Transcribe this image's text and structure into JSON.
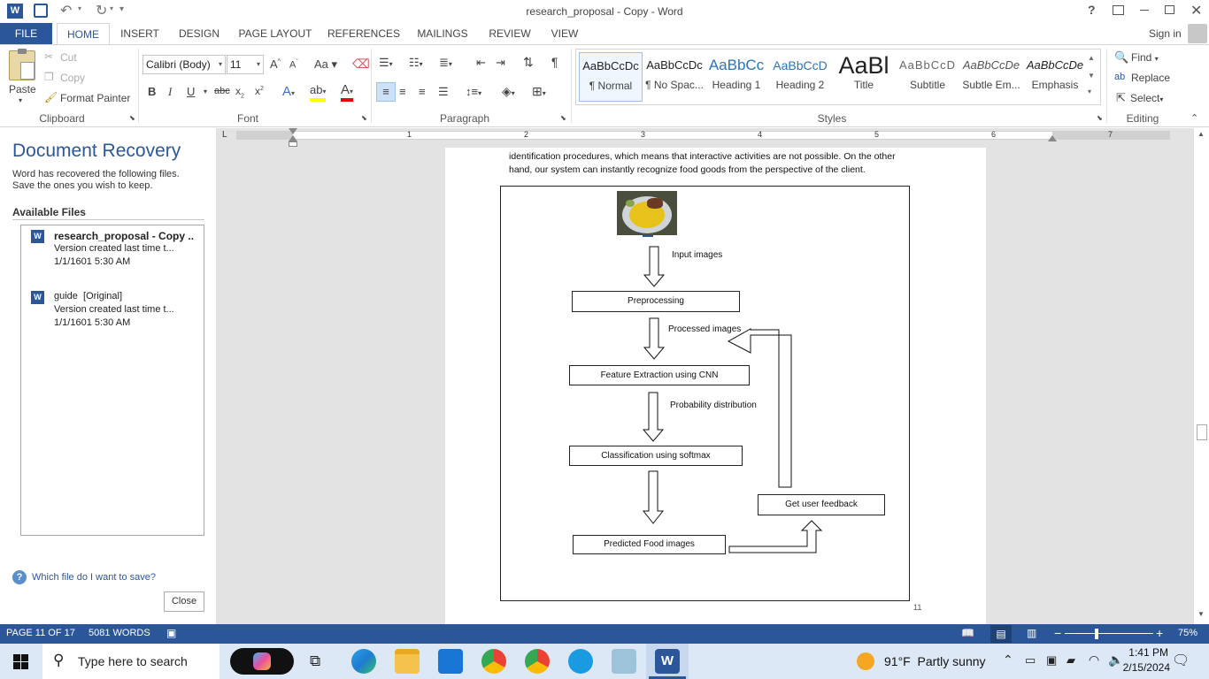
{
  "window": {
    "title": "research_proposal - Copy - Word",
    "sign_in": "Sign in",
    "help": "?"
  },
  "tabs": [
    "FILE",
    "HOME",
    "INSERT",
    "DESIGN",
    "PAGE LAYOUT",
    "REFERENCES",
    "MAILINGS",
    "REVIEW",
    "VIEW"
  ],
  "clipboard": {
    "paste": "Paste",
    "cut": "Cut",
    "copy": "Copy",
    "format_painter": "Format Painter",
    "label": "Clipboard"
  },
  "font": {
    "name": "Calibri (Body)",
    "size": "11",
    "label": "Font"
  },
  "paragraph": {
    "label": "Paragraph"
  },
  "styles": {
    "label": "Styles",
    "items": [
      {
        "sample": "AaBbCcDc",
        "name": "¶ Normal"
      },
      {
        "sample": "AaBbCcDc",
        "name": "¶ No Spac..."
      },
      {
        "sample": "AaBbCc",
        "name": "Heading 1"
      },
      {
        "sample": "AaBbCcD",
        "name": "Heading 2"
      },
      {
        "sample": "AaBl",
        "name": "Title"
      },
      {
        "sample": "AaBbCcD",
        "name": "Subtitle"
      },
      {
        "sample": "AaBbCcDe",
        "name": "Subtle Em..."
      },
      {
        "sample": "AaBbCcDe",
        "name": "Emphasis"
      }
    ]
  },
  "editing": {
    "find": "Find",
    "replace": "Replace",
    "select": "Select",
    "label": "Editing"
  },
  "recovery": {
    "title": "Document Recovery",
    "desc": "Word has recovered the following files. Save the ones you wish to keep.",
    "available": "Available Files",
    "files": [
      {
        "name": "research_proposal - Copy ..",
        "detail": "Version created last time t...",
        "date": "1/1/1601 5:30 AM"
      },
      {
        "name": "guide  [Original]",
        "detail": "Version created last time t...",
        "date": "1/1/1601 5:30 AM"
      }
    ],
    "help_link": "Which file do I want to save?",
    "close": "Close"
  },
  "ruler_numbers": [
    "1",
    "2",
    "3",
    "4",
    "5",
    "6",
    "7"
  ],
  "document": {
    "text_line1": "identification procedures, which means that interactive activities are not possible. On the other",
    "text_line2": "hand, our system can instantly recognize food goods from the perspective of the client.",
    "page_number": "11",
    "flow": {
      "input_label": "Input images",
      "preprocessing": "Preprocessing",
      "processed_label": "Processed images",
      "feature": "Feature Extraction using CNN",
      "prob_label": "Probability distribution",
      "classification": "Classification using softmax",
      "feedback": "Get user feedback",
      "predicted": "Predicted Food images"
    }
  },
  "status": {
    "page": "PAGE 11 OF 17",
    "words": "5081 WORDS",
    "zoom": "75%"
  },
  "taskbar": {
    "search_placeholder": "Type here to search",
    "weather": "91°F  Partly sunny",
    "time": "1:41 PM",
    "date": "2/15/2024"
  }
}
